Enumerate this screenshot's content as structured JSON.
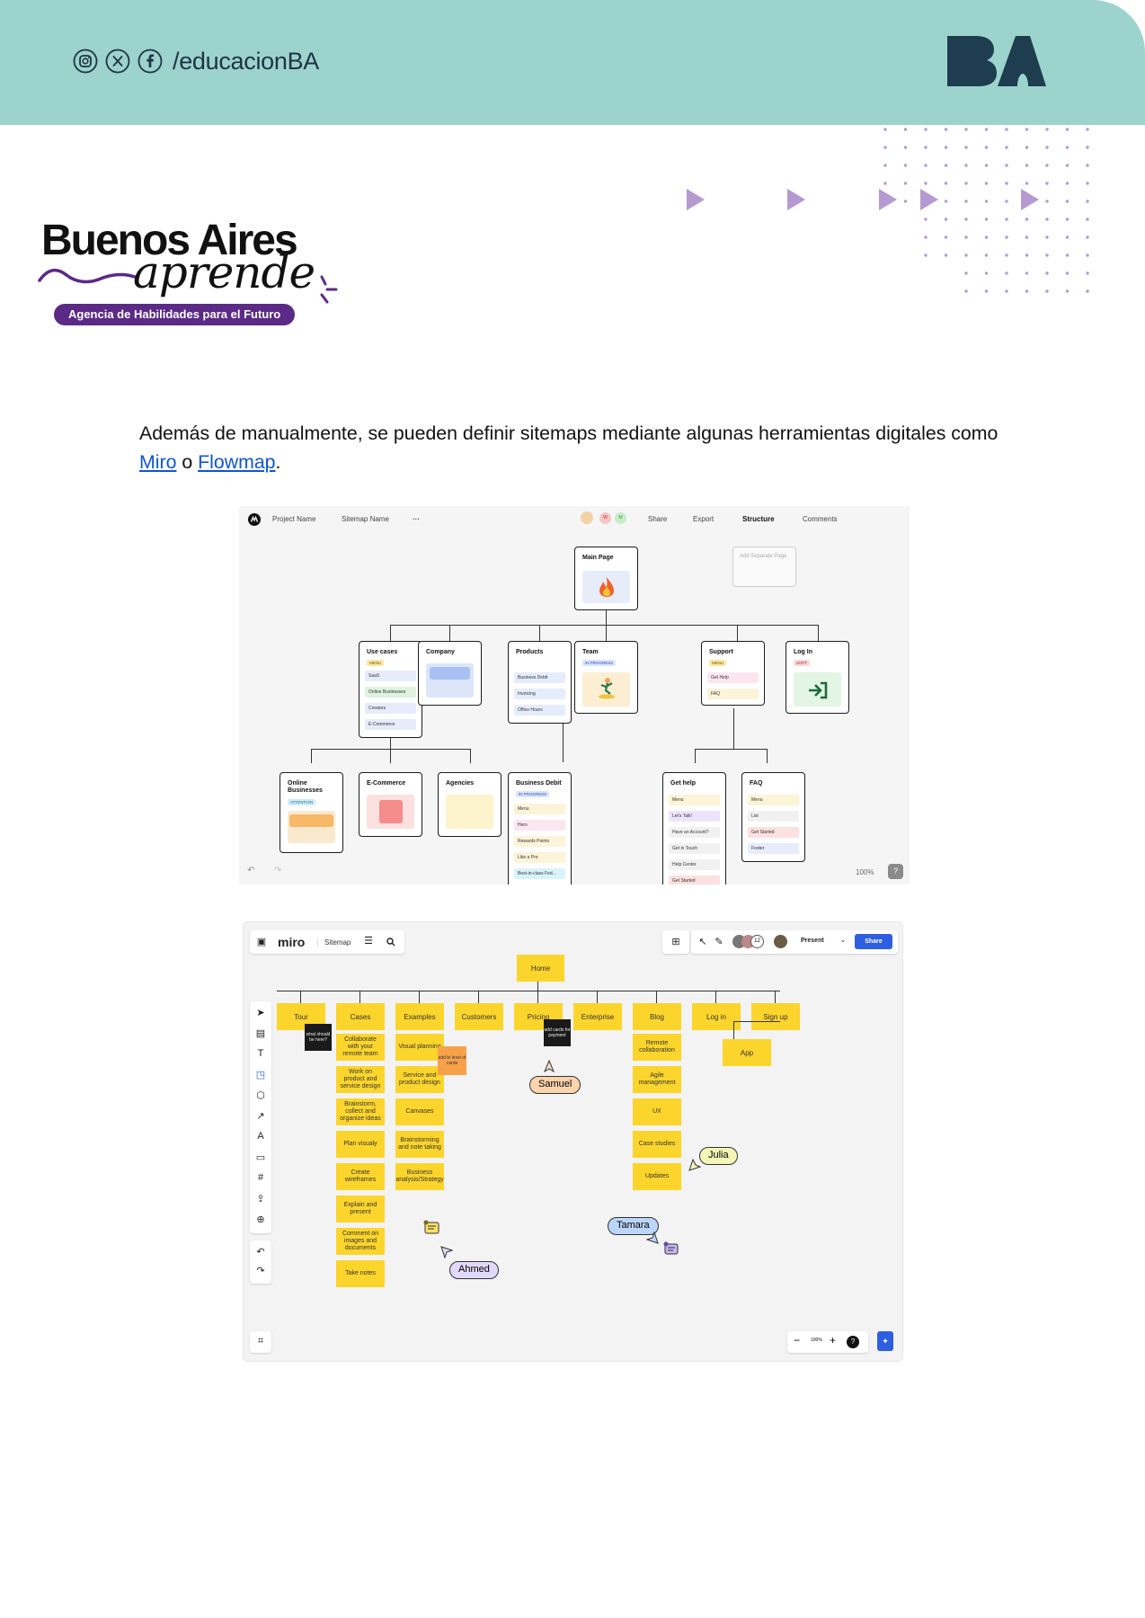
{
  "header": {
    "social_handle": "/educacionBA",
    "social_icons": [
      "instagram-icon",
      "x-icon",
      "facebook-icon"
    ],
    "logo_text": "BA",
    "band_color": "#9dd3cd",
    "logo_color": "#1e3d4f"
  },
  "brand": {
    "line1": "Buenos Aires",
    "line2": "aprende",
    "badge": "Agencia de Habilidades para el Futuro",
    "accent_color": "#5b2a86"
  },
  "content": {
    "text_before": "Además de manualmente, se pueden definir sitemaps mediante algunas herramientas digitales como ",
    "link1": "Miro",
    "text_between": " o ",
    "link2": "Flowmap",
    "text_after": "."
  },
  "flowmap": {
    "top_left": [
      "Project Name",
      "Sitemap Name",
      "···"
    ],
    "top_right": [
      "Share",
      "Export",
      "Structure",
      "Comments"
    ],
    "avatars": [
      "W",
      "M"
    ],
    "zoom": "100%",
    "help": "?",
    "add_page": "Add Separate Page",
    "main_page": "Main Page",
    "level1": [
      {
        "title": "Use cases",
        "tag": "MENU",
        "rows": [
          "SaaS",
          "Online Businesses",
          "Creators",
          "E-Commerce"
        ]
      },
      {
        "title": "Company",
        "tag": "",
        "rows": []
      },
      {
        "title": "Products",
        "tag": "",
        "rows": [
          "Business Debit",
          "Invoicing",
          "Office Hours"
        ]
      },
      {
        "title": "Team",
        "tag": "IN PROGRESS",
        "rows": []
      },
      {
        "title": "Support",
        "tag": "MENU",
        "rows": [
          "Get Help",
          "FAQ"
        ]
      },
      {
        "title": "Log In",
        "tag": "SOFT",
        "rows": []
      }
    ],
    "level2": [
      {
        "title": "Online Businesses",
        "tag": "ATTENTION",
        "rows": []
      },
      {
        "title": "E-Commerce",
        "tag": "",
        "rows": []
      },
      {
        "title": "Agencies",
        "tag": "",
        "rows": []
      },
      {
        "title": "Business Debit",
        "tag": "IN PROGRESS",
        "rows": [
          "Menu",
          "Hero",
          "Rewards Points",
          "Like a Pro",
          "Best-in-class Fed..."
        ]
      },
      {
        "title": "Get help",
        "tag": "",
        "rows": [
          "Menu",
          "Let's Talk!",
          "Have an Account?",
          "Get in Touch",
          "Help Center",
          "Get Started"
        ]
      },
      {
        "title": "FAQ",
        "tag": "",
        "rows": [
          "Menu",
          "List",
          "Get Started",
          "Footer"
        ]
      }
    ]
  },
  "miro": {
    "logo": "miro",
    "board": "Sitemap",
    "present": "Present",
    "share": "Share",
    "avatar_count": "12",
    "zoom": "100%",
    "home": "Home",
    "columns": [
      {
        "head": "Tour",
        "items": []
      },
      {
        "head": "Cases",
        "items": [
          "Collaborate with your remote team",
          "Work on product and service design",
          "Brainstorm, collect and organize ideas",
          "Plan visualy",
          "Create wireframes",
          "Explain and present",
          "Comment on images and documents",
          "Take notes"
        ]
      },
      {
        "head": "Examples",
        "items": [
          "Visual planning",
          "Service and product design",
          "Canvases",
          "Brainstorming and note taking",
          "Business analysis/Strategy"
        ]
      },
      {
        "head": "Customers",
        "items": []
      },
      {
        "head": "Pricing",
        "items": []
      },
      {
        "head": "Enterprise",
        "items": []
      },
      {
        "head": "Blog",
        "items": [
          "Remote collaboration",
          "Agile management",
          "UX",
          "Case studies",
          "Updates"
        ]
      },
      {
        "head": "Log in",
        "items": []
      },
      {
        "head": "Sign up",
        "items": []
      }
    ],
    "app": "App",
    "notes": [
      "what should be here?",
      "add cards for payment"
    ],
    "orange_note": "add bi level of cards",
    "cursors": [
      "Samuel",
      "Julia",
      "Tamara",
      "Ahmed"
    ],
    "colors": {
      "sticky": "#fcd52c",
      "share": "#2f5fe0"
    }
  }
}
